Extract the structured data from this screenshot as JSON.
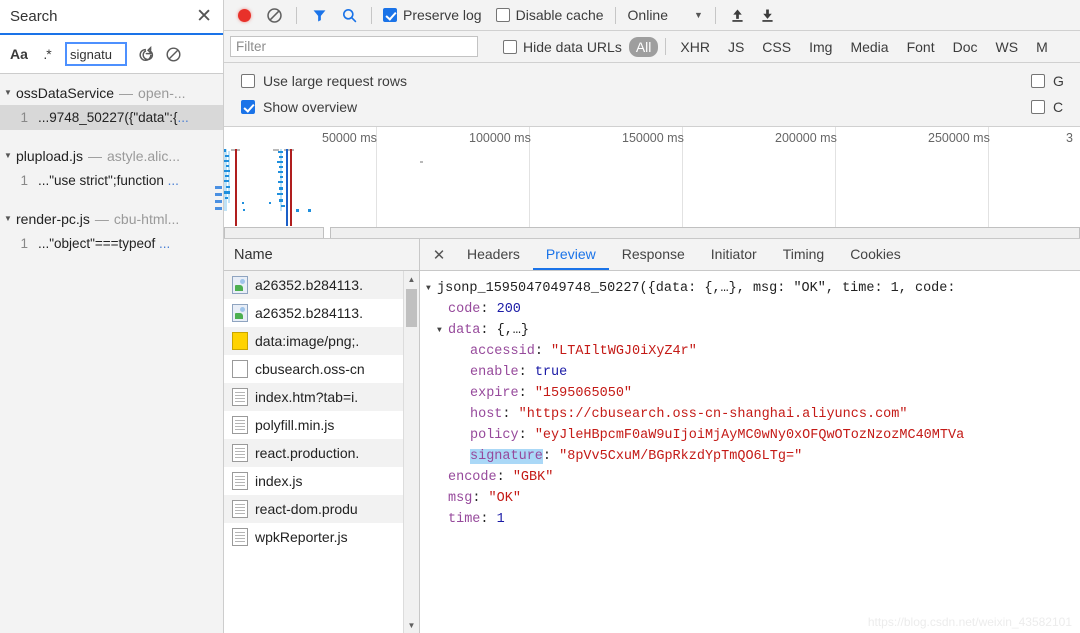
{
  "search_panel": {
    "title": "Search",
    "close_label": "✕",
    "toolbar": {
      "match_case_label": "Aa",
      "regex_label": ".*",
      "query_value": "signatu",
      "query_placeholder": "",
      "refresh_label": "⟳",
      "clear_label": "⦸"
    },
    "results": [
      {
        "file": "ossDataService",
        "separator": "—",
        "url": "open-...",
        "matches": [
          {
            "line": "1",
            "pre": "...9748_50227({\"data\":{",
            "post": "...",
            "selected": true
          }
        ]
      },
      {
        "file": "plupload.js",
        "separator": "—",
        "url": "astyle.alic...",
        "matches": [
          {
            "line": "1",
            "pre": "...\"use strict\";function ",
            "post": "...",
            "selected": false
          }
        ]
      },
      {
        "file": "render-pc.js",
        "separator": "—",
        "url": "cbu-html...",
        "matches": [
          {
            "line": "1",
            "pre": "...\"object\"===typeof ",
            "post": "...",
            "selected": false
          }
        ]
      }
    ]
  },
  "network": {
    "toolbar": {
      "record_icon": "record-dot",
      "clear_icon": "clear-icon",
      "filter_icon": "funnel-icon",
      "search_icon": "magnifier-icon",
      "preserve_log_label": "Preserve log",
      "preserve_log_checked": true,
      "disable_cache_label": "Disable cache",
      "disable_cache_checked": false,
      "throttle_value": "Online",
      "caret": "▼",
      "import_icon": "upload-arrow-icon",
      "export_icon": "download-arrow-icon"
    },
    "filterbar": {
      "filter_placeholder": "Filter",
      "filter_value": "",
      "hide_data_urls_label": "Hide data URLs",
      "hide_data_urls_checked": false,
      "types": [
        "All",
        "XHR",
        "JS",
        "CSS",
        "Img",
        "Media",
        "Font",
        "Doc",
        "WS",
        "M"
      ],
      "active_type": "All"
    },
    "settings": {
      "use_large_rows_label": "Use large request rows",
      "use_large_rows_checked": false,
      "show_overview_label": "Show overview",
      "show_overview_checked": true,
      "group_by_frame_label": "G",
      "group_by_frame_checked": false,
      "capture_screenshots_label": "C",
      "capture_screenshots_checked": false
    },
    "overview": {
      "ticks": [
        "50000 ms",
        "100000 ms",
        "150000 ms",
        "200000 ms",
        "250000 ms",
        "3"
      ]
    },
    "request_list": {
      "column_header": "Name",
      "rows": [
        {
          "icon": "image-file-icon",
          "name": "a26352.b284113."
        },
        {
          "icon": "image-file-icon",
          "name": "a26352.b284113."
        },
        {
          "icon": "yellow-file-icon",
          "name": "data:image/png;."
        },
        {
          "icon": "blank-file-icon",
          "name": "cbusearch.oss-cn"
        },
        {
          "icon": "document-file-icon",
          "name": "index.htm?tab=i."
        },
        {
          "icon": "document-file-icon",
          "name": "polyfill.min.js"
        },
        {
          "icon": "document-file-icon",
          "name": "react.production."
        },
        {
          "icon": "document-file-icon",
          "name": "index.js"
        },
        {
          "icon": "document-file-icon",
          "name": "react-dom.produ"
        },
        {
          "icon": "document-file-icon",
          "name": "wpkReporter.js"
        }
      ]
    },
    "detail": {
      "close_label": "✕",
      "tabs": [
        "Headers",
        "Preview",
        "Response",
        "Initiator",
        "Timing",
        "Cookies"
      ],
      "active_tab": "Preview",
      "preview": {
        "root_line": "jsonp_1595047049748_50227({data: {,…}, msg: \"OK\", time: 1, code:",
        "entries": [
          {
            "indent": 2,
            "key": "code",
            "value": "200",
            "kind": "num",
            "tri": ""
          },
          {
            "indent": 1,
            "key": "data",
            "value": "{,…}",
            "kind": "plain",
            "tri": "▼"
          },
          {
            "indent": 3,
            "key": "accessid",
            "value": "\"LTAIltWGJ0iXyZ4r\"",
            "kind": "str",
            "tri": ""
          },
          {
            "indent": 3,
            "key": "enable",
            "value": "true",
            "kind": "bool",
            "tri": ""
          },
          {
            "indent": 3,
            "key": "expire",
            "value": "\"1595065050\"",
            "kind": "str",
            "tri": ""
          },
          {
            "indent": 3,
            "key": "host",
            "value": "\"https://cbusearch.oss-cn-shanghai.aliyuncs.com\"",
            "kind": "str",
            "tri": ""
          },
          {
            "indent": 3,
            "key": "policy",
            "value": "\"eyJleHBpcmF0aW9uIjoiMjAyMC0wNy0xOFQwOTozNzozMC40MTVa",
            "kind": "str",
            "tri": ""
          },
          {
            "indent": 3,
            "key": "signature",
            "value": "\"8pVv5CxuM/BGpRkzdYpTmQO6LTg=\"",
            "kind": "str",
            "tri": "",
            "highlight": true
          },
          {
            "indent": 2,
            "key": "encode",
            "value": "\"GBK\"",
            "kind": "str",
            "tri": ""
          },
          {
            "indent": 2,
            "key": "msg",
            "value": "\"OK\"",
            "kind": "str",
            "tri": ""
          },
          {
            "indent": 2,
            "key": "time",
            "value": "1",
            "kind": "num",
            "tri": ""
          }
        ]
      }
    }
  },
  "watermark": "https://blog.csdn.net/weixin_43582101",
  "colors": {
    "accent": "#1a73e8",
    "record_red": "#e8312a",
    "toolbar_bg": "#f3f3f3",
    "string_red": "#c41a16",
    "key_purple": "#96499b",
    "number_blue": "#1a1aa6",
    "highlight_blue": "#aad8f7"
  }
}
